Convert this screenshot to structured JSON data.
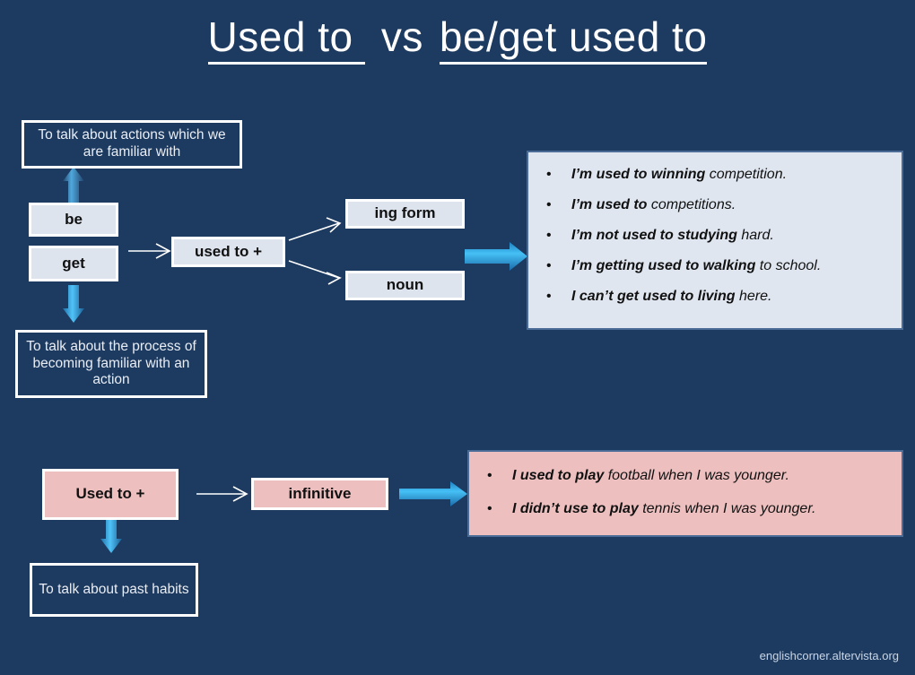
{
  "title": {
    "part1": "Used to ",
    "separator": "vs",
    "part2": "be/get used to"
  },
  "colors": {
    "background": "#1d3a60",
    "box_light_fill": "#dde4ee",
    "box_pink_fill": "#eebfbf",
    "panel_light_fill": "#dfe6f0",
    "panel_border": "#4a6c96",
    "outline_border": "#ffffff",
    "blue_arrow": "#29a8e0",
    "white_arrow": "#ffffff",
    "footer_text": "#c9d6e6"
  },
  "top_section": {
    "purpose_be": "To talk about actions which we are familiar  with",
    "purpose_get": "To talk about  the process of  becoming familiar with an action",
    "verb_be": "be",
    "verb_get": "get",
    "structure": "used to +",
    "complement_ing": "ing form",
    "complement_noun": "noun",
    "examples": [
      {
        "bold": "I’m used to winning",
        "rest": " competition."
      },
      {
        "bold": "I’m used to",
        "rest": " competitions."
      },
      {
        "bold": "I’m not used to studying",
        "rest": " hard."
      },
      {
        "bold": "I’m getting  used to walking",
        "rest": " to school."
      },
      {
        "bold": "I can’t get used to living",
        "rest": " here."
      }
    ]
  },
  "bottom_section": {
    "structure": "Used to +",
    "complement": "infinitive",
    "purpose": "To talk about past habits",
    "examples": [
      {
        "bold": "I used to play",
        "rest": " football when I was younger."
      },
      {
        "bold": "I didn’t use to play",
        "rest": "  tennis when I was younger."
      }
    ]
  },
  "footer": {
    "credit": "englishcorner.altervista.org"
  },
  "icons": {
    "arrow_right": "arrow-right-icon",
    "arrow_up": "arrow-up-icon",
    "arrow_down": "arrow-down-icon",
    "block_arrow_right": "block-arrow-right-icon"
  }
}
